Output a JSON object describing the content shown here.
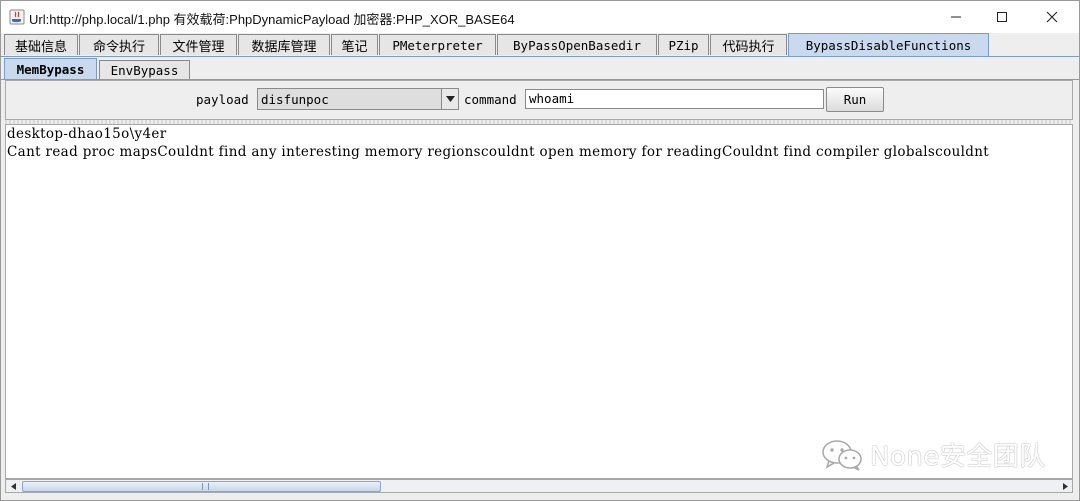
{
  "window": {
    "title": "Url:http://php.local/1.php 有效载荷:PhpDynamicPayload 加密器:PHP_XOR_BASE64",
    "icons": [
      "java-app-icon",
      "minimize-icon",
      "maximize-icon",
      "close-icon"
    ]
  },
  "tabs": [
    {
      "label": "基础信息"
    },
    {
      "label": "命令执行"
    },
    {
      "label": "文件管理"
    },
    {
      "label": "数据库管理"
    },
    {
      "label": "笔记"
    },
    {
      "label": "PMeterpreter"
    },
    {
      "label": "ByPassOpenBasedir"
    },
    {
      "label": "PZip"
    },
    {
      "label": "代码执行"
    },
    {
      "label": "BypassDisableFunctions",
      "selected": true
    }
  ],
  "subtabs": [
    {
      "label": "MemBypass",
      "selected": true
    },
    {
      "label": "EnvBypass"
    }
  ],
  "form": {
    "payload_label": "payload",
    "payload_value": "disfunpoc",
    "command_label": "command",
    "command_value": "whoami",
    "run_label": "Run"
  },
  "output": {
    "lines": [
      "desktop-dhao15o\\y4er",
      "Cant read proc mapsCouldnt find any interesting memory regionscouldnt open memory for readingCouldnt find compiler globalscouldnt"
    ]
  },
  "watermark": {
    "text": "None安全团队"
  },
  "colors": {
    "selected_tab": "#c9d9ee",
    "tab_border": "#7a9cc6",
    "background": "#eeeeee"
  }
}
